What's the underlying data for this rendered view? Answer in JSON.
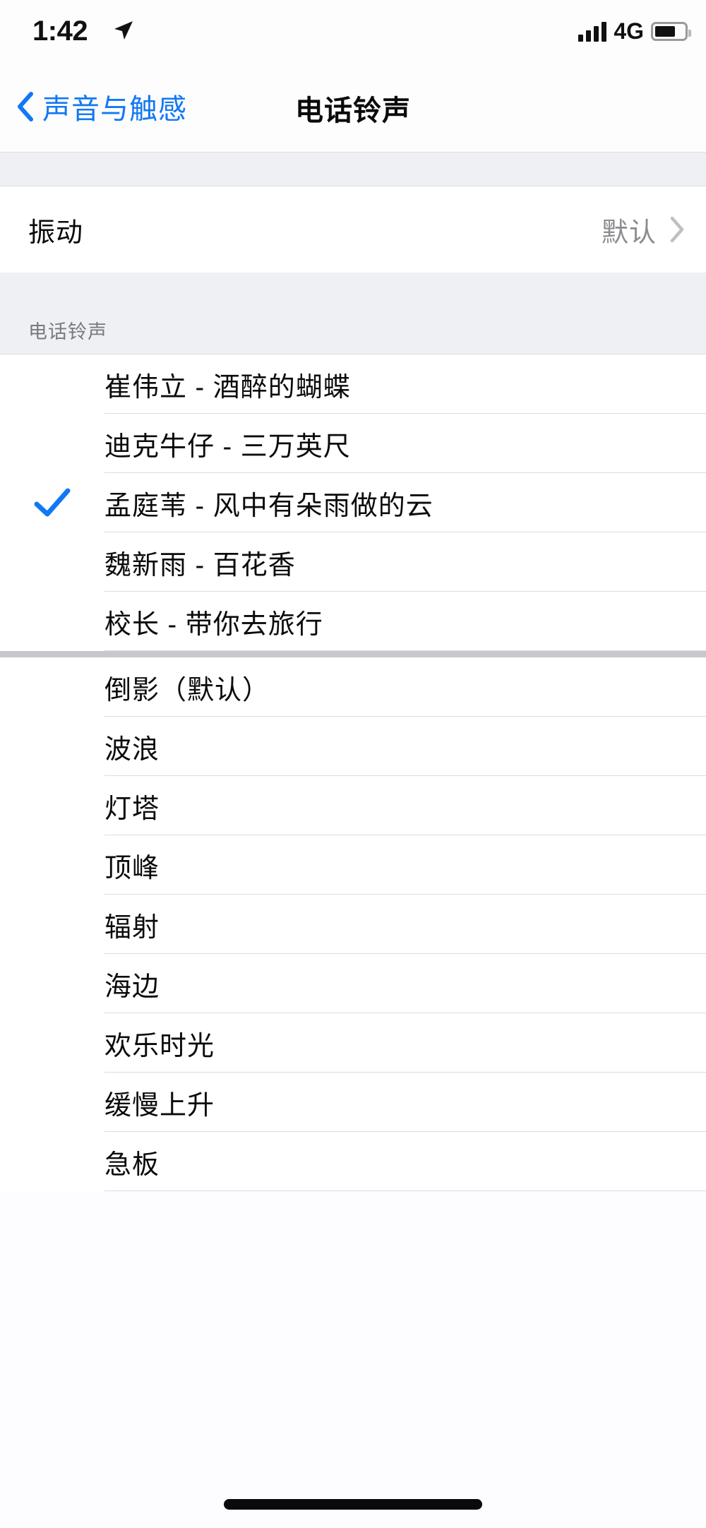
{
  "status_bar": {
    "time": "1:42",
    "location_icon": "location-arrow-icon",
    "signal_icon": "cellular-signal-icon",
    "network": "4G",
    "battery_icon": "battery-icon"
  },
  "nav": {
    "back_icon": "chevron-left-icon",
    "back_label": "声音与触感",
    "title": "电话铃声"
  },
  "vibration": {
    "label": "振动",
    "value": "默认",
    "chevron_icon": "chevron-right-icon"
  },
  "section": {
    "header": "电话铃声"
  },
  "custom_tones": [
    {
      "label": "崔伟立 - 酒醉的蝴蝶",
      "selected": false
    },
    {
      "label": "迪克牛仔 - 三万英尺",
      "selected": false
    },
    {
      "label": "孟庭苇 - 风中有朵雨做的云",
      "selected": true
    },
    {
      "label": "魏新雨 - 百花香",
      "selected": false
    },
    {
      "label": "校长 - 带你去旅行",
      "selected": false
    }
  ],
  "default_tones": [
    {
      "label": "倒影（默认）",
      "selected": false
    },
    {
      "label": "波浪",
      "selected": false
    },
    {
      "label": "灯塔",
      "selected": false
    },
    {
      "label": "顶峰",
      "selected": false
    },
    {
      "label": "辐射",
      "selected": false
    },
    {
      "label": "海边",
      "selected": false
    },
    {
      "label": "欢乐时光",
      "selected": false
    },
    {
      "label": "缓慢上升",
      "selected": false
    },
    {
      "label": "急板",
      "selected": false
    }
  ],
  "colors": {
    "accent_blue": "#1278f3",
    "group_bg": "#eff0f4",
    "separator": "#dcdce0",
    "secondary_text": "#8b8b90"
  }
}
